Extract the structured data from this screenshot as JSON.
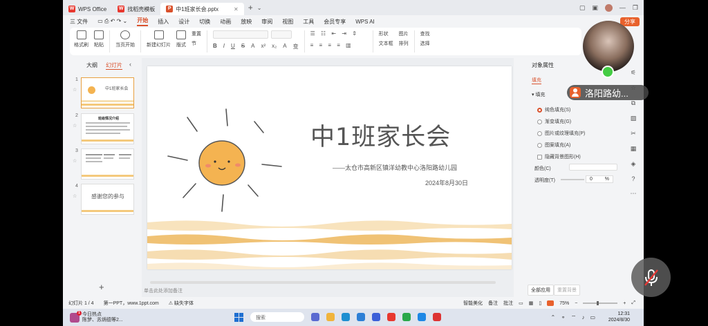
{
  "titlebar": {
    "tabs": [
      {
        "label": "WPS Office",
        "logo": "W"
      },
      {
        "label": "找稻壳模板",
        "logo": "W"
      },
      {
        "label": "中1班家长会.pptx",
        "logo": "P"
      }
    ]
  },
  "menubar": {
    "file": "三 文件",
    "items": [
      "开始",
      "插入",
      "设计",
      "切换",
      "动画",
      "放映",
      "审阅",
      "视图",
      "工具",
      "会员专享",
      "WPS AI"
    ],
    "active": "开始",
    "share": "分享"
  },
  "ribbon": {
    "format_painter": "格式刷",
    "paste": "粘贴",
    "from_current": "当页开始",
    "new_slide": "新建幻灯片",
    "layout": "版式",
    "section": "节",
    "reset": "重置",
    "format_buttons": [
      "B",
      "I",
      "U",
      "S",
      "A",
      "x²",
      "x₂",
      "A",
      "变"
    ],
    "shape": "形状",
    "picture": "图片",
    "textbox": "文本框",
    "arrange": "排列",
    "find": "查找",
    "select": "选择"
  },
  "left_panel": {
    "tab_outline": "大纲",
    "tab_slides": "幻灯片",
    "thumbnails": [
      {
        "num": "1",
        "title": "中1班家长会"
      },
      {
        "num": "2",
        "title": "班级情况介绍"
      },
      {
        "num": "3",
        "title": ""
      },
      {
        "num": "4",
        "title": "感谢您的参与"
      }
    ]
  },
  "slide": {
    "title": "中1班家长会",
    "subtitle": "——太仓市高新区镇洋幼教中心洛阳路幼儿园",
    "date": "2024年8月30日"
  },
  "notes_placeholder": "单击此处添加备注",
  "right_panel": {
    "title": "对象属性",
    "tab": "填充",
    "section": "填充",
    "options": [
      "纯色填充(S)",
      "渐变填充(G)",
      "图片或纹理填充(P)",
      "图案填充(A)"
    ],
    "hide_bg": "隐藏背景图形(H)",
    "color_label": "颜色(C)",
    "transparency_label": "透明度(T)",
    "transparency_value": "0",
    "transparency_unit": "%",
    "apply_all": "全部应用",
    "reset_bg": "重置背景"
  },
  "statusbar": {
    "slide_info": "幻灯片 1 / 4",
    "theme": "第一PPT，www.1ppt.com",
    "missing_font": "缺失字体",
    "smart_beautify": "智能美化",
    "notes": "备注",
    "comments": "批注",
    "zoom": "75%"
  },
  "taskbar": {
    "news_title": "今日热点",
    "news_sub": "陈梦、苏炳德等2...",
    "search_placeholder": "搜索",
    "time": "12:31",
    "date": "2024/8/30"
  },
  "overlay": {
    "participant_name": "洛阳路幼..."
  }
}
